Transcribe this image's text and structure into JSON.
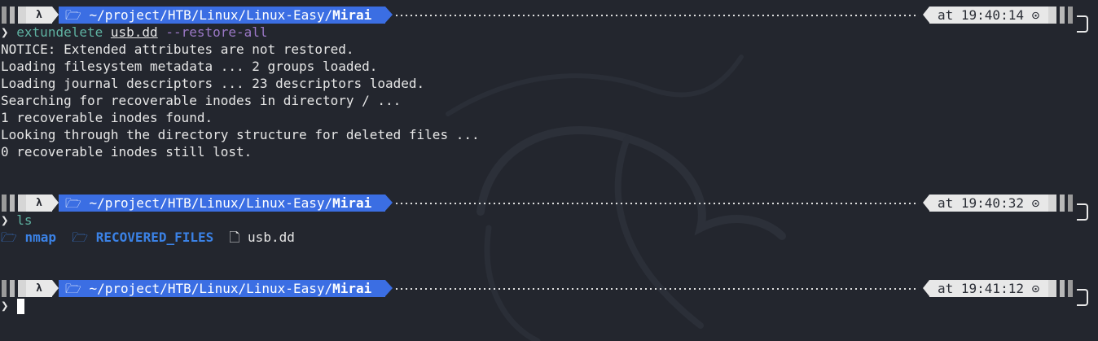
{
  "colors": {
    "background": "#23262e",
    "path_segment": "#3b6ee3",
    "light_segment": "#e8e8e8",
    "command_green": "#5fb2a2",
    "option_purple": "#9b78c6",
    "directory_blue": "#3b82e6"
  },
  "prompts": [
    {
      "lambda": "λ",
      "folder_icon": "🗁",
      "path": "~/project/HTB/Linux/Linux-Easy/",
      "dir": "Mirai",
      "time_label": "at 19:40:14",
      "clock_icon": "⊙"
    },
    {
      "lambda": "λ",
      "folder_icon": "🗁",
      "path": "~/project/HTB/Linux/Linux-Easy/",
      "dir": "Mirai",
      "time_label": "at 19:40:32",
      "clock_icon": "⊙"
    },
    {
      "lambda": "λ",
      "folder_icon": "🗁",
      "path": "~/project/HTB/Linux/Linux-Easy/",
      "dir": "Mirai",
      "time_label": "at 19:41:12",
      "clock_icon": "⊙"
    }
  ],
  "commands": [
    {
      "chevron": "❯",
      "program": "extundelete",
      "arg": "usb.dd",
      "option": "--restore-all"
    },
    {
      "chevron": "❯",
      "program": "ls"
    },
    {
      "chevron": "❯"
    }
  ],
  "output": [
    "NOTICE: Extended attributes are not restored.",
    "Loading filesystem metadata ... 2 groups loaded.",
    "Loading journal descriptors ... 23 descriptors loaded.",
    "Searching for recoverable inodes in directory / ...",
    "1 recoverable inodes found.",
    "Looking through the directory structure for deleted files ...",
    "0 recoverable inodes still lost."
  ],
  "ls_listing": [
    {
      "icon": "🗁",
      "name": "nmap",
      "kind": "directory"
    },
    {
      "icon": "🗁",
      "name": "RECOVERED_FILES",
      "kind": "directory"
    },
    {
      "icon": "🗋",
      "name": "usb.dd",
      "kind": "file"
    }
  ]
}
